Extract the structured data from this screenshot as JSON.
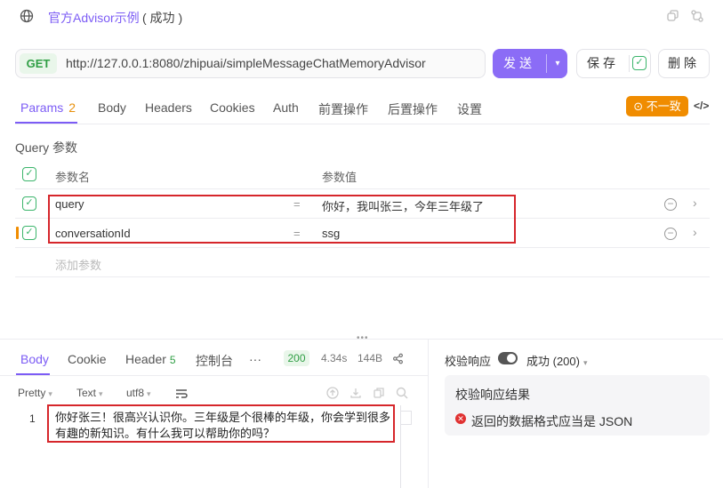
{
  "header": {
    "name": "官方Advisor示例",
    "status": "( 成功 )"
  },
  "request": {
    "method": "GET",
    "url": "http://127.0.0.1:8080/zhipuai/simpleMessageChatMemoryAdvisor",
    "send_label": "发送",
    "save_label": "保存",
    "delete_label": "删除"
  },
  "tabs": [
    {
      "label": "Params",
      "count": "2"
    },
    {
      "label": "Body"
    },
    {
      "label": "Headers"
    },
    {
      "label": "Cookies"
    },
    {
      "label": "Auth"
    },
    {
      "label": "前置操作"
    },
    {
      "label": "后置操作"
    },
    {
      "label": "设置"
    }
  ],
  "mismatch_label": "不一致",
  "params": {
    "section_title": "Query 参数",
    "col_name": "参数名",
    "col_value": "参数值",
    "rows": [
      {
        "name": "query",
        "eq": "=",
        "value": "你好，我叫张三，今年三年级了"
      },
      {
        "name": "conversationId",
        "eq": "=",
        "value": "ssg"
      }
    ],
    "add_placeholder": "添加参数"
  },
  "response": {
    "tabs": [
      {
        "label": "Body"
      },
      {
        "label": "Cookie"
      },
      {
        "label": "Header",
        "count": "5"
      },
      {
        "label": "控制台"
      },
      {
        "label": "···"
      }
    ],
    "status_code": "200",
    "time": "4.34s",
    "size": "144B",
    "format": [
      "Pretty",
      "Text",
      "utf8"
    ],
    "line_no": "1",
    "body_text": "你好张三！很高兴认识你。三年级是个很棒的年级，你会学到很多有趣的新知识。有什么我可以帮助你的吗？"
  },
  "validation": {
    "label": "校验响应",
    "selected": "成功 (200)",
    "card_title": "校验响应结果",
    "error": "返回的数据格式应当是 JSON"
  },
  "colors": {
    "accent": "#7c5cf5",
    "send_bg": "#8b6cf6",
    "success": "#2f9e44",
    "warning": "#f08c00",
    "error": "#e03131",
    "highlight_box": "#d6262b"
  }
}
